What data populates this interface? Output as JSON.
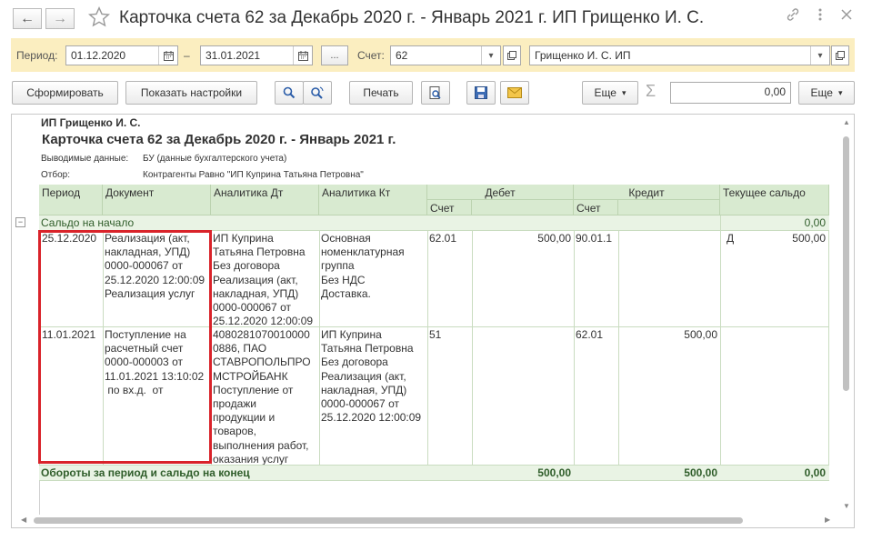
{
  "window": {
    "title": "Карточка счета 62 за Декабрь 2020 г. - Январь 2021 г. ИП Грищенко И. С.",
    "nav_back": "←",
    "nav_forward": "→"
  },
  "filter": {
    "period_label": "Период:",
    "period_from": "01.12.2020",
    "period_dash": "–",
    "period_to": "31.01.2021",
    "period_select_button": "...",
    "account_label": "Счет:",
    "account_value": "62",
    "organization_value": "Грищенко И. С. ИП"
  },
  "toolbar": {
    "generate_label": "Сформировать",
    "settings_label": "Показать настройки",
    "print_label": "Печать",
    "more_label_1": "Еще",
    "sum_value": "0,00",
    "more_label_2": "Еще"
  },
  "report": {
    "org": "ИП Грищенко И. С.",
    "heading": "Карточка счета 62 за Декабрь 2020 г. - Январь 2021 г.",
    "output_label": "Выводимые данные:",
    "output_value": "БУ (данные бухгалтерского учета)",
    "filter_label": "Отбор:",
    "filter_value": "Контрагенты Равно \"ИП Куприна Татьяна Петровна\"",
    "columns": {
      "period": "Период",
      "document": "Документ",
      "analytics_dt": "Аналитика Дт",
      "analytics_kt": "Аналитика Кт",
      "debit": "Дебет",
      "credit": "Кредит",
      "balance": "Текущее сальдо",
      "account": "Счет"
    },
    "opening": {
      "label": "Сальдо на начало",
      "toggle": "−",
      "value": "0,00"
    },
    "rows": [
      {
        "period": "25.12.2020",
        "document": "Реализация (акт,\nнакладная, УПД)\n0000-000067 от\n25.12.2020 12:00:09\nРеализация услуг",
        "analytics_dt": "ИП Куприна\nТатьяна Петровна\nБез договора\nРеализация (акт,\nнакладная, УПД)\n0000-000067 от\n25.12.2020 12:00:09",
        "analytics_kt": "Основная\nноменклатурная\nгруппа\nБез НДС\nДоставка.",
        "debit_account": "62.01",
        "debit_amount": "500,00",
        "credit_account": "90.01.1",
        "credit_amount": "",
        "balance_side": "Д",
        "balance_amount": "500,00"
      },
      {
        "period": "11.01.2021",
        "document": "Поступление на\nрасчетный счет\n0000-000003 от\n11.01.2021 13:10:02\n по вх.д.  от",
        "analytics_dt": "4080281070010000\n0886, ПАО\nСТАВРОПОЛЬПРО\nМСТРОЙБАНК\nПоступление от\nпродажи\nпродукции и\nтоваров,\nвыполнения работ,\nоказания услуг",
        "analytics_kt": "ИП Куприна\nТатьяна Петровна\nБез договора\nРеализация (акт,\nнакладная, УПД)\n0000-000067 от\n25.12.2020 12:00:09",
        "debit_account": "51",
        "debit_amount": "",
        "credit_account": "62.01",
        "credit_amount": "500,00",
        "balance_side": "",
        "balance_amount": ""
      }
    ],
    "totals": {
      "label": "Обороты за период и сальдо на конец",
      "debit": "500,00",
      "credit": "500,00",
      "balance": "0,00"
    }
  },
  "colors": {
    "filter_bar_bg": "#fbeec0",
    "header_bg": "#d8ead0",
    "highlight_border": "#d9232a",
    "totals_text": "#2f5d2a"
  },
  "icons": [
    "back-arrow-icon",
    "forward-arrow-icon",
    "star-icon",
    "link-icon",
    "more-vertical-icon",
    "close-icon",
    "calendar-icon",
    "dropdown-icon",
    "open-icon",
    "search-icon",
    "refresh-search-icon",
    "preview-icon",
    "save-icon",
    "email-icon",
    "sigma-icon"
  ]
}
